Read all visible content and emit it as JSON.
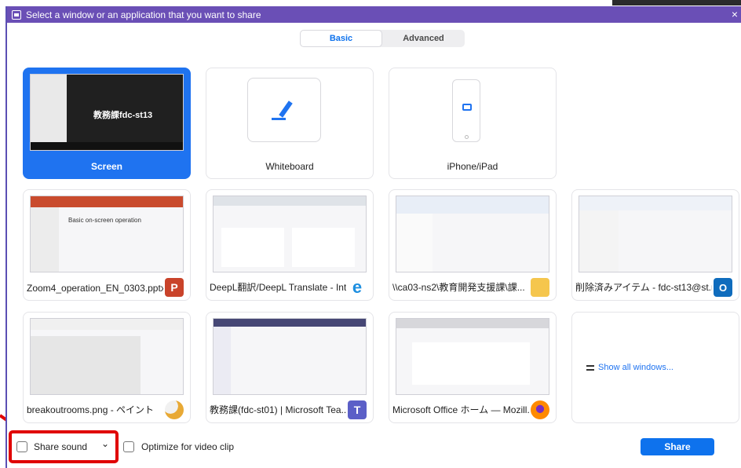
{
  "title_bar": {
    "title": "Select a window or an application that you want to share",
    "close_label": "×"
  },
  "tabs": {
    "basic": "Basic",
    "advanced": "Advanced"
  },
  "tiles": [
    {
      "label": "Screen",
      "thumb_text": "教務課fdc-st13"
    },
    {
      "label": "Whiteboard"
    },
    {
      "label": "iPhone/iPad"
    },
    {
      "label": "Zoom4_operation_EN_0303.pptx ...",
      "thumb_text": "Basic on-screen operation",
      "app_icon_text": "P"
    },
    {
      "label": "DeepL翻訳/DeepL Translate - Int...",
      "app_icon_text": "e"
    },
    {
      "label": "\\\\ca03-ns2\\教育開発支援課\\課..."
    },
    {
      "label": "削除済みアイテム - fdc-st13@st.ri...",
      "app_icon_text": "O"
    },
    {
      "label": "breakoutrooms.png - ペイント"
    },
    {
      "label": "教務課(fdc-st01) | Microsoft Tea...",
      "app_icon_text": "T"
    },
    {
      "label": "Microsoft Office ホーム — Mozill..."
    }
  ],
  "show_all": "Show all windows...",
  "bottom": {
    "share_sound": "Share sound",
    "share_sound_chevron": "⌄",
    "optimize": "Optimize for video clip",
    "share_button": "Share"
  },
  "colors": {
    "title_bar": "#6a4fb6",
    "accent": "#1f73f0",
    "highlight": "#e00000"
  }
}
